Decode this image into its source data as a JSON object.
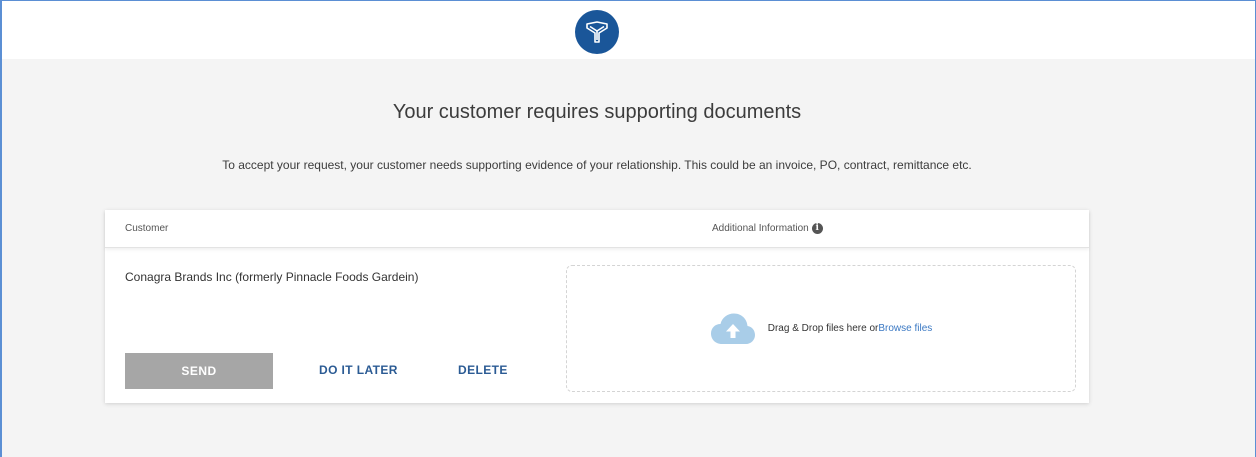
{
  "header": {
    "logo_icon": "brand-logo-icon",
    "brand_color": "#1a5699"
  },
  "main": {
    "title": "Your customer requires supporting documents",
    "subtitle": "To accept your request, your customer needs supporting evidence of your relationship. This could be an invoice, PO, contract, remittance etc."
  },
  "table": {
    "col_customer": "Customer",
    "col_additional": "Additional Information",
    "info_icon": "info-icon",
    "info_glyph": "i"
  },
  "row": {
    "customer_name": "Conagra Brands Inc (formerly Pinnacle Foods Gardein)",
    "send_label": "SEND",
    "later_label": "DO IT LATER",
    "delete_label": "DELETE"
  },
  "dropzone": {
    "icon": "cloud-upload-icon",
    "text": "Drag & Drop files here or ",
    "browse_label": "Browse files",
    "link_color": "#3a78c3"
  }
}
